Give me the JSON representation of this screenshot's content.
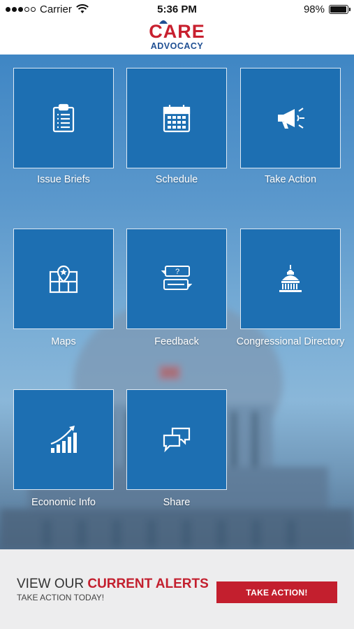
{
  "status_bar": {
    "carrier": "Carrier",
    "time": "5:36 PM",
    "battery": "98%"
  },
  "header": {
    "logo_top": "CARE",
    "logo_bottom": "ADVOCACY"
  },
  "tiles": [
    {
      "label": "Issue Briefs",
      "icon": "clipboard-icon"
    },
    {
      "label": "Schedule",
      "icon": "calendar-icon"
    },
    {
      "label": "Take Action",
      "icon": "megaphone-icon"
    },
    {
      "label": "Maps",
      "icon": "map-icon"
    },
    {
      "label": "Feedback",
      "icon": "feedback-icon"
    },
    {
      "label": "Congressional Directory",
      "icon": "capitol-icon"
    },
    {
      "label": "Economic Info",
      "icon": "growth-chart-icon"
    },
    {
      "label": "Share",
      "icon": "chat-bubbles-icon"
    }
  ],
  "footer": {
    "title_prefix": "VIEW OUR ",
    "title_highlight": "CURRENT ALERTS",
    "subtitle": "TAKE ACTION TODAY!",
    "button_label": "TAKE ACTION!"
  },
  "colors": {
    "brand_red": "#c31f2e",
    "brand_blue": "#1f4f93",
    "tile_blue": "#1d6fb2"
  }
}
